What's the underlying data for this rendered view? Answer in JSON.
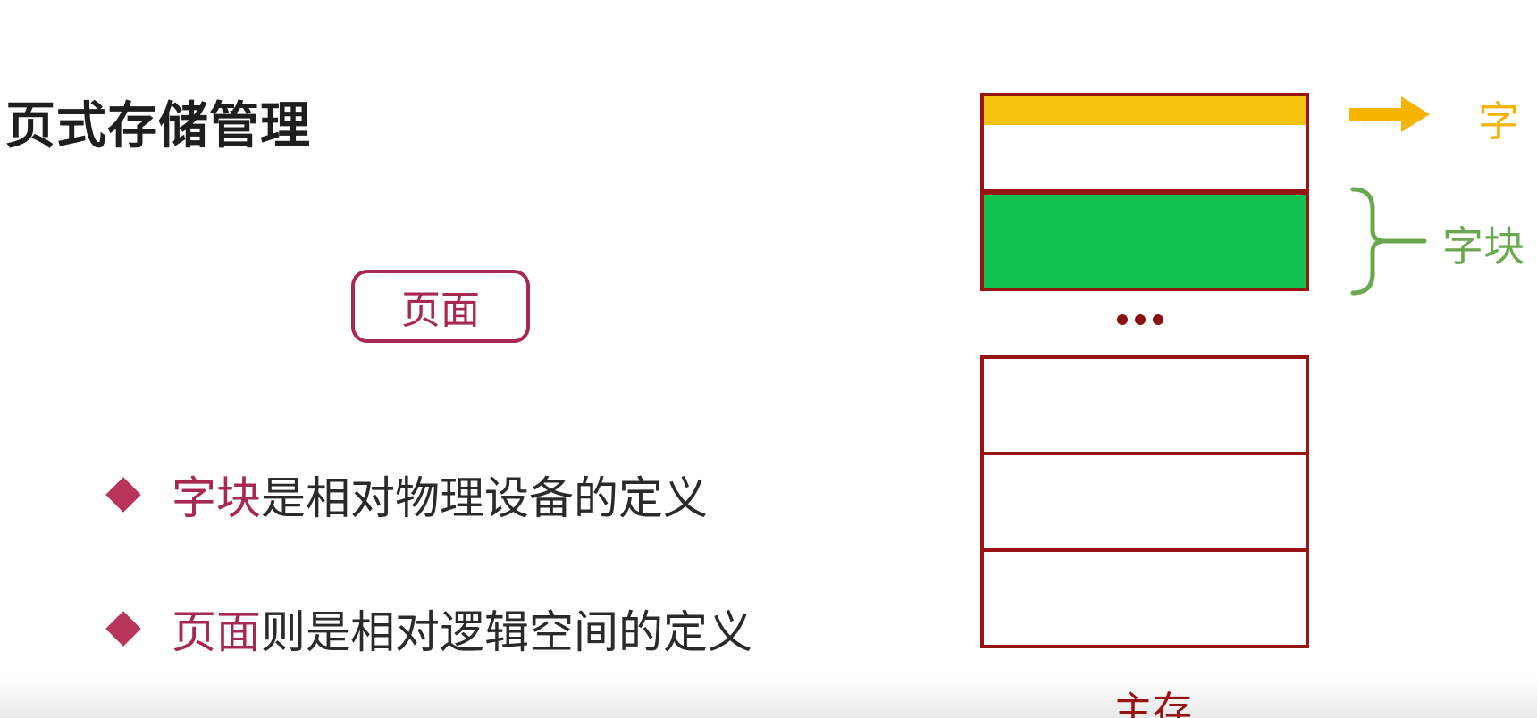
{
  "slide": {
    "title": "页式存储管理",
    "tag_label": "页面",
    "bullets": [
      {
        "highlight": "字块",
        "rest": "是相对物理设备的定义"
      },
      {
        "highlight": "页面",
        "rest": "则是相对逻辑空间的定义"
      }
    ]
  },
  "diagram": {
    "arrow_label": "字",
    "brace_label": "字块",
    "ellipsis": "…",
    "memory_label": "主存",
    "colors": {
      "border": "#961414",
      "word": "#f4c20f",
      "block": "#13c352",
      "arrow": "#f4b400",
      "brace": "#6aa84f",
      "accent": "#a8294f"
    }
  }
}
